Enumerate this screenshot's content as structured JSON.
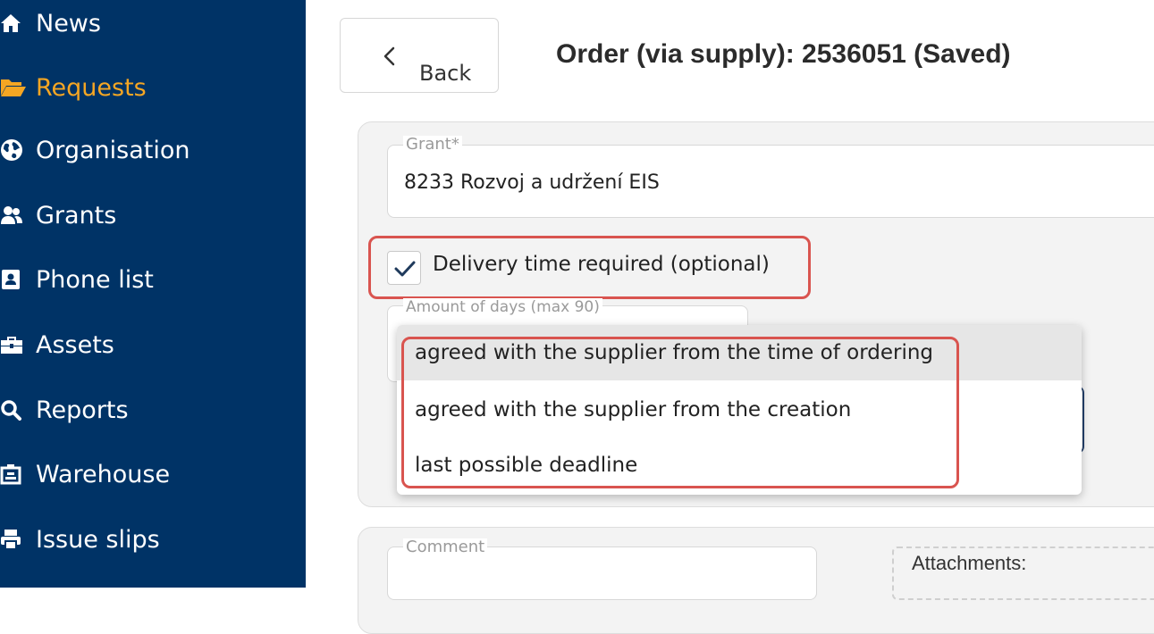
{
  "sidebar": {
    "items": [
      {
        "label": "News",
        "icon": "home-icon",
        "active": false
      },
      {
        "label": "Requests",
        "icon": "folder-open-icon",
        "active": true
      },
      {
        "label": "Organisation",
        "icon": "globe-icon",
        "active": false
      },
      {
        "label": "Grants",
        "icon": "users-icon",
        "active": false
      },
      {
        "label": "Phone list",
        "icon": "address-book-icon",
        "active": false
      },
      {
        "label": "Assets",
        "icon": "toolbox-icon",
        "active": false
      },
      {
        "label": "Reports",
        "icon": "search-icon",
        "active": false
      },
      {
        "label": "Warehouse",
        "icon": "warehouse-icon",
        "active": false
      },
      {
        "label": "Issue slips",
        "icon": "print-icon",
        "active": false
      }
    ],
    "background": "#003366",
    "active_color": "#f5a623"
  },
  "header": {
    "back_label": "Back",
    "title": "Order (via supply): 2536051 (Saved)"
  },
  "form": {
    "grant": {
      "legend": "Grant*",
      "value": "8233 Rozvoj a udržení EIS"
    },
    "delivery": {
      "label": "Delivery time required (optional)",
      "checked": true
    },
    "days": {
      "legend": "Amount of days (max 90)"
    },
    "dropdown_options": [
      "agreed with the supplier from the time of ordering",
      "agreed with the supplier from the creation",
      "last possible deadline"
    ],
    "comment": {
      "legend": "Comment"
    },
    "attachments": {
      "label": "Attachments:"
    }
  },
  "highlight_color": "#d9544f"
}
